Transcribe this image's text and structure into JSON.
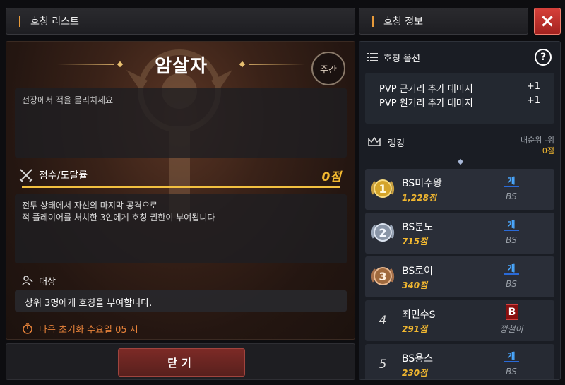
{
  "header": {
    "left_title": "호칭 리스트",
    "right_title": "호칭 정보",
    "close_icon": "×"
  },
  "title": {
    "name": "암살자",
    "period_badge": "주간",
    "description": "전장에서 적을 물리치세요"
  },
  "score": {
    "label": "점수/도달률",
    "value": "0점",
    "progress": 1.0
  },
  "condition_text_1": "전투 상태에서 자신의 마지막 공격으로",
  "condition_text_2": "적 플레이어를 처치한 3인에게 호칭 권한이 부여됩니다",
  "target": {
    "label": "대상",
    "text": "상위 3명에게 호칭을 부여합니다."
  },
  "reset": {
    "text": "다음 초기화 수요일 05 시"
  },
  "bottom": {
    "close_label": "닫기"
  },
  "options": {
    "label": "호칭 옵션",
    "help": "?",
    "lines": [
      {
        "name": "PVP 근거리 추가 대미지",
        "value": "+1"
      },
      {
        "name": "PVP 원거리 추가 대미지",
        "value": "+1"
      }
    ]
  },
  "ranking": {
    "label": "랭킹",
    "my_rank_label": "내순위 -위",
    "my_score": "0점",
    "rows": [
      {
        "rank": "1",
        "name": "BS미수왕",
        "score": "1,228점",
        "guild_mark": "개",
        "guild": "BS",
        "medal": "gold"
      },
      {
        "rank": "2",
        "name": "BS분노",
        "score": "715점",
        "guild_mark": "개",
        "guild": "BS",
        "medal": "silver"
      },
      {
        "rank": "3",
        "name": "BS로이",
        "score": "340점",
        "guild_mark": "개",
        "guild": "BS",
        "medal": "bronze"
      },
      {
        "rank": "4",
        "name": "죄민수S",
        "score": "291점",
        "guild_mark": "B",
        "guild": "깡철이",
        "medal": ""
      },
      {
        "rank": "5",
        "name": "BS용스",
        "score": "230점",
        "guild_mark": "개",
        "guild": "BS",
        "medal": ""
      }
    ]
  },
  "colors": {
    "accent": "#e79a3a",
    "score_gold": "#f2b830",
    "close_red": "#c0302c",
    "guild_blue": "#4aa8ff"
  }
}
